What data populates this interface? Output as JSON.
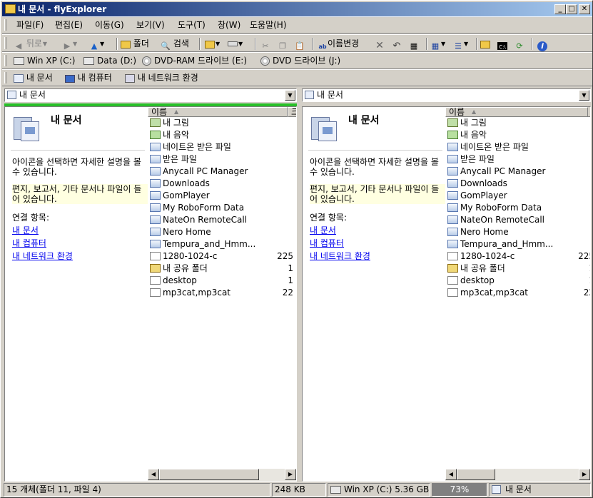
{
  "window": {
    "title": "내 문서 - flyExplorer",
    "min": "_",
    "max": "□",
    "close": "✕"
  },
  "menu": [
    "파일(F)",
    "편집(E)",
    "이동(G)",
    "보기(V)",
    "도구(T)",
    "창(W)",
    "도움말(H)"
  ],
  "toolbar": {
    "back": "뒤로",
    "folder": "폴더",
    "search": "검색",
    "rename": "이름변경"
  },
  "drives": [
    "Win XP (C:)",
    "Data (D:)",
    "DVD-RAM 드라이브 (E:)",
    "DVD 드라이브 (J:)"
  ],
  "favorites": [
    "내 문서",
    "내 컴퓨터",
    "내 네트워크 환경"
  ],
  "pane": {
    "address": "내 문서",
    "title": "내 문서",
    "description": "아이콘을 선택하면 자세한 설명을 볼 수 있습니다.",
    "note": "편지, 보고서, 기타 문서나 파일이 들어 있습니다.",
    "related_label": "연결 항목:",
    "related": [
      "내 문서",
      "내 컴퓨터",
      "내 네트워크 환경"
    ],
    "column_name": "이름",
    "files": [
      {
        "name": "내 그림",
        "type": "pictures",
        "size": ""
      },
      {
        "name": "내 음악",
        "type": "music",
        "size": ""
      },
      {
        "name": "네이트온 받은 파일",
        "type": "folder",
        "size": ""
      },
      {
        "name": "받은 파일",
        "type": "folder",
        "size": ""
      },
      {
        "name": "Anycall PC Manager",
        "type": "folder",
        "size": ""
      },
      {
        "name": "Downloads",
        "type": "folder",
        "size": ""
      },
      {
        "name": "GomPlayer",
        "type": "folder",
        "size": ""
      },
      {
        "name": "My RoboForm Data",
        "type": "folder",
        "size": ""
      },
      {
        "name": "NateOn RemoteCall",
        "type": "folder",
        "size": ""
      },
      {
        "name": "Nero Home",
        "type": "folder",
        "size": ""
      },
      {
        "name": "Tempura_and_Hmm...",
        "type": "folder",
        "size": ""
      },
      {
        "name": "1280-1024-c",
        "type": "file",
        "size": "225"
      },
      {
        "name": "내 공유 폴더",
        "type": "shared",
        "size": "1"
      },
      {
        "name": "desktop",
        "type": "file",
        "size": "1"
      },
      {
        "name": "mp3cat,mp3cat",
        "type": "file",
        "size": "22"
      }
    ]
  },
  "status": {
    "count": "15 개체(폴더 11, 파일 4)",
    "size": "248 KB",
    "drive": "Win XP (C:) 5.36 GB",
    "percent": "73%",
    "location": "내 문서"
  }
}
